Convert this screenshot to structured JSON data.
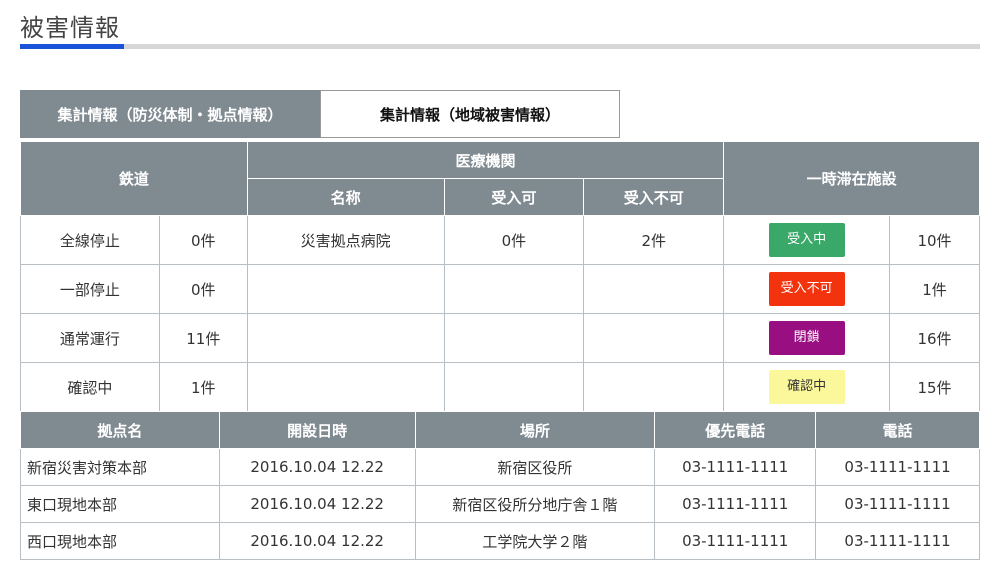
{
  "page": {
    "title": "被害情報"
  },
  "tabs": [
    {
      "label": "集計情報（防災体制・拠点情報）",
      "active": false
    },
    {
      "label": "集計情報（地域被害情報）",
      "active": true
    }
  ],
  "summary": {
    "headers": {
      "railway": "鉄道",
      "medical": "医療機関",
      "medical_name": "名称",
      "medical_accept": "受入可",
      "medical_reject": "受入不可",
      "shelter": "一時滞在施設"
    },
    "rows": [
      {
        "rail_status": "全線停止",
        "rail_count": "0件",
        "med_name": "災害拠点病院",
        "med_accept": "0件",
        "med_reject": "2件",
        "shelter_status": "受入中",
        "shelter_color": "#3aa868",
        "shelter_text_color": "#ffffff",
        "shelter_count": "10件"
      },
      {
        "rail_status": "一部停止",
        "rail_count": "0件",
        "med_name": "",
        "med_accept": "",
        "med_reject": "",
        "shelter_status": "受入不可",
        "shelter_color": "#f3330e",
        "shelter_text_color": "#ffffff",
        "shelter_count": "1件"
      },
      {
        "rail_status": "通常運行",
        "rail_count": "11件",
        "med_name": "",
        "med_accept": "",
        "med_reject": "",
        "shelter_status": "閉鎖",
        "shelter_color": "#990f82",
        "shelter_text_color": "#ffffff",
        "shelter_count": "16件"
      },
      {
        "rail_status": "確認中",
        "rail_count": "1件",
        "med_name": "",
        "med_accept": "",
        "med_reject": "",
        "shelter_status": "確認中",
        "shelter_color": "#fbf79b",
        "shelter_text_color": "#333333",
        "shelter_count": "15件"
      }
    ]
  },
  "bases": {
    "headers": [
      "拠点名",
      "開設日時",
      "場所",
      "優先電話",
      "電話"
    ],
    "rows": [
      {
        "name": "新宿災害対策本部",
        "opened": "2016.10.04 12.22",
        "place": "新宿区役所",
        "priority_phone": "03-1111-1111",
        "phone": "03-1111-1111"
      },
      {
        "name": "東口現地本部",
        "opened": "2016.10.04 12.22",
        "place": "新宿区役所分地庁舎１階",
        "priority_phone": "03-1111-1111",
        "phone": "03-1111-1111"
      },
      {
        "name": "西口現地本部",
        "opened": "2016.10.04 12.22",
        "place": "工学院大学２階",
        "priority_phone": "03-1111-1111",
        "phone": "03-1111-1111"
      }
    ]
  }
}
